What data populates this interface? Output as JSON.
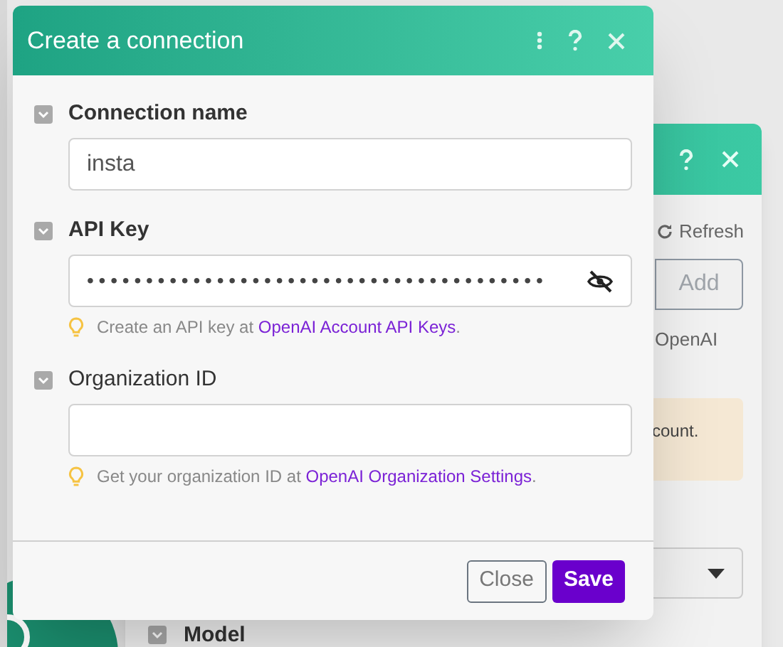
{
  "background_panel": {
    "refresh": "Refresh",
    "add_button": "Add",
    "note": "OpenAI",
    "warning": "count.",
    "section_label": "Model"
  },
  "dialog": {
    "title": "Create a connection",
    "fields": [
      {
        "label": "Connection name",
        "required": true,
        "kind": "text",
        "value": "insta"
      },
      {
        "label": "API Key",
        "required": true,
        "kind": "password",
        "value": "•••••••••••••••••••••••••••••••••••••••",
        "hint": {
          "before": "Create an API key at ",
          "link": "OpenAI Account API Keys",
          "after": "."
        }
      },
      {
        "label": "Organization ID",
        "required": false,
        "kind": "text",
        "hint": {
          "before": "Get your organization ID at ",
          "link": "OpenAI Organization Settings",
          "after": "."
        }
      }
    ],
    "buttons": [
      {
        "label": "Close",
        "kind": "secondary"
      },
      {
        "label": "Save",
        "kind": "primary"
      }
    ]
  }
}
